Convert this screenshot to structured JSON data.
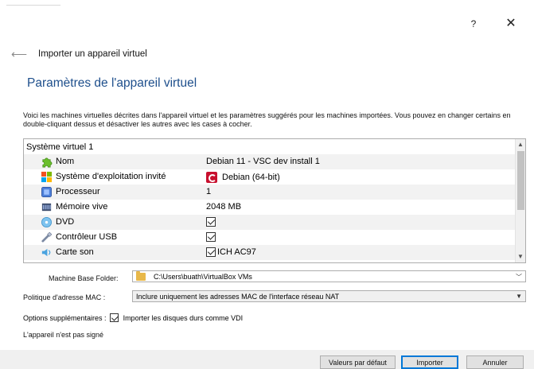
{
  "window": {
    "help_label": "?",
    "close_label": "✕"
  },
  "breadcrumb": {
    "title": "Importer un appareil virtuel"
  },
  "page": {
    "heading": "Paramètres de l'appareil virtuel",
    "description": "Voici les machines virtuelles décrites dans l'appareil virtuel et les paramètres suggérés pour les machines importées. Vous pouvez en changer certains en double-cliquant dessus et désactiver les autres avec les cases à cocher."
  },
  "tree": {
    "group": "Système virtuel 1",
    "rows": [
      {
        "icon": "puzzle-icon",
        "label": "Nom",
        "value": "Debian 11 - VSC dev install 1"
      },
      {
        "icon": "os-icon",
        "label": "Système d'exploitation invité",
        "value": "Debian (64-bit)"
      },
      {
        "icon": "cpu-icon",
        "label": "Processeur",
        "value": "1"
      },
      {
        "icon": "memory-icon",
        "label": "Mémoire vive",
        "value": "2048 MB"
      },
      {
        "icon": "dvd-icon",
        "label": "DVD",
        "value": ""
      },
      {
        "icon": "usb-icon",
        "label": "Contrôleur USB",
        "value": ""
      },
      {
        "icon": "sound-icon",
        "label": "Carte son",
        "value": "ICH AC97"
      }
    ]
  },
  "form": {
    "folder_label": "Machine Base Folder:",
    "folder_value": "C:\\Users\\buath\\VirtualBox VMs",
    "mac_label": "Politique d'adresse MAC :",
    "mac_value": "Inclure uniquement les adresses MAC de l'interface réseau NAT",
    "options_label": "Options supplémentaires :",
    "options_check": "Importer les disques durs comme VDI",
    "signed_text": "L'appareil n'est pas signé"
  },
  "buttons": {
    "defaults": "Valeurs par défaut",
    "import": "Importer",
    "cancel": "Annuler"
  },
  "colors": {
    "heading": "#1e4f8c",
    "accent": "#0078d7"
  }
}
